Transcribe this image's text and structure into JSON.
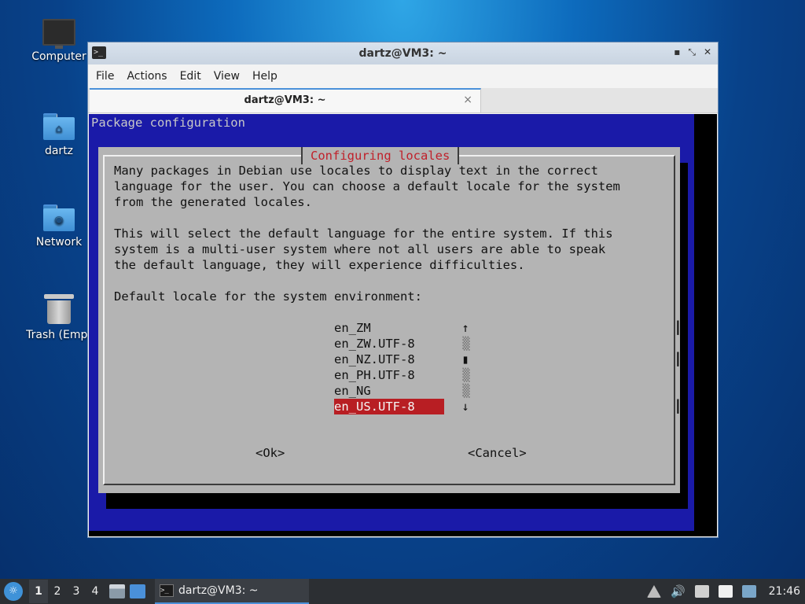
{
  "desktop": {
    "icons": [
      {
        "label": "Computer",
        "icon": "computer-icon"
      },
      {
        "label": "dartz",
        "icon": "home-folder-icon"
      },
      {
        "label": "Network",
        "icon": "network-folder-icon"
      },
      {
        "label": "Trash (Empt",
        "icon": "trash-icon"
      }
    ]
  },
  "window": {
    "title": "dartz@VM3: ~",
    "menu": [
      "File",
      "Actions",
      "Edit",
      "View",
      "Help"
    ],
    "tab_label": "dartz@VM3: ~",
    "tab_close": "×",
    "controls": {
      "minimize": "▪",
      "maximize": "⤡",
      "close": "✕"
    }
  },
  "terminal": {
    "header": "Package configuration",
    "dialog": {
      "title": "Configuring locales",
      "text": "Many packages in Debian use locales to display text in the correct\nlanguage for the user. You can choose a default locale for the system\nfrom the generated locales.\n\nThis will select the default language for the entire system. If this\nsystem is a multi-user system where not all users are able to speak\nthe default language, they will experience difficulties.\n\nDefault locale for the system environment:",
      "list": [
        "en_ZM",
        "en_ZW.UTF-8",
        "en_NZ.UTF-8",
        "en_PH.UTF-8",
        "en_NG",
        "en_US.UTF-8"
      ],
      "selected_index": 5,
      "scroll": [
        "↑",
        "▒",
        "▮",
        "▒",
        "▒",
        "↓"
      ],
      "ok": "<Ok>",
      "cancel": "<Cancel>"
    }
  },
  "taskbar": {
    "start_glyph": "☼",
    "workspaces": [
      "1",
      "2",
      "3",
      "4"
    ],
    "active_workspace": 0,
    "task_label": "dartz@VM3: ~",
    "clock": "21:46",
    "accent": "#4a90d9"
  }
}
